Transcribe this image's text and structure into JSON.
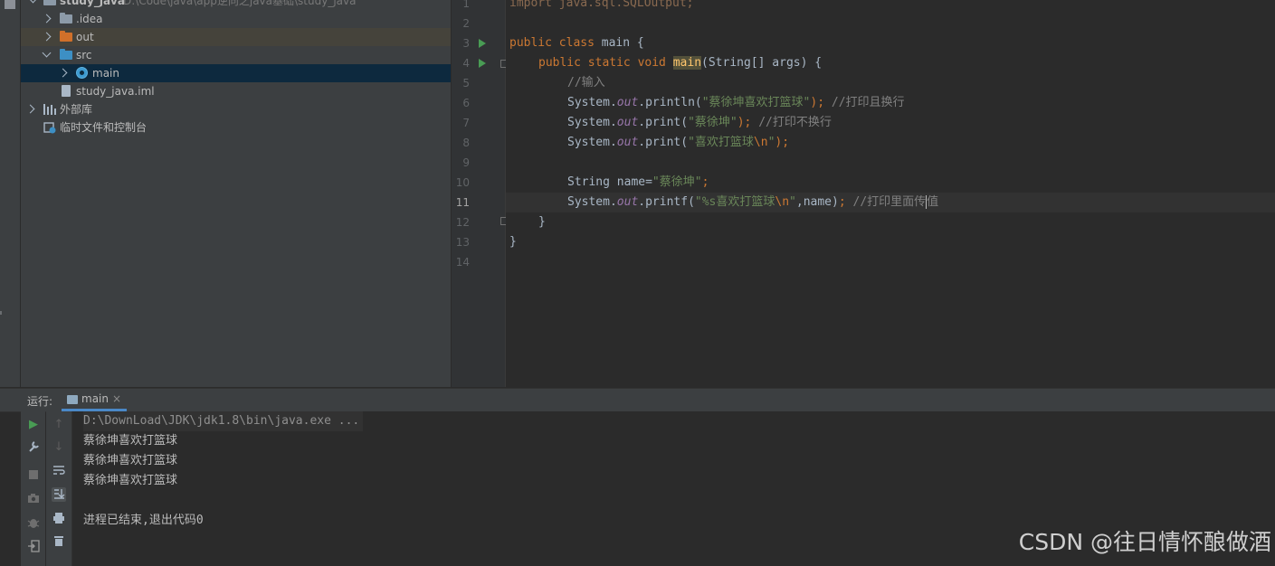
{
  "project_tree": {
    "root": {
      "name": "study_java",
      "path": "D:\\Code\\java\\app逆向之java基础\\study_java"
    },
    "items": [
      {
        "label": "idea",
        "prefix": "."
      },
      {
        "label": "out"
      },
      {
        "label": "src"
      },
      {
        "label": "main"
      },
      {
        "label": "study_java.iml"
      },
      {
        "label": "外部库"
      },
      {
        "label": "临时文件和控制台"
      }
    ]
  },
  "editor": {
    "line_numbers": [
      "1",
      "2",
      "3",
      "4",
      "5",
      "6",
      "7",
      "8",
      "9",
      "10",
      "11",
      "12",
      "13",
      "14"
    ],
    "current_line": "11",
    "lines": {
      "l1": "import java.sql.SQLOutput;",
      "l3_kw": "public class",
      "l3_name": " main {",
      "l4_kw": "public static void",
      "l4_method": "main",
      "l4_rest": "(String[] args) {",
      "l5_cmt": "//输入",
      "l6_a": "System.",
      "l6_field": "out",
      "l6_b": ".println(",
      "l6_str": "\"蔡徐坤喜欢打篮球\"",
      "l6_c": ");",
      "l6_cmt": " //打印且换行",
      "l7_a": "System.",
      "l7_field": "out",
      "l7_b": ".print(",
      "l7_str": "\"蔡徐坤\"",
      "l7_c": ");",
      "l7_cmt": " //打印不换行",
      "l8_a": "System.",
      "l8_field": "out",
      "l8_b": ".print(",
      "l8_str": "\"喜欢打篮球",
      "l8_esc": "\\n",
      "l8_str2": "\"",
      "l8_c": ");",
      "l10_a": "String name=",
      "l10_str": "\"蔡徐坤\"",
      "l10_c": ";",
      "l11_a": "System.",
      "l11_field": "out",
      "l11_b": ".printf(",
      "l11_str": "\"%s喜欢打篮球",
      "l11_esc": "\\n",
      "l11_str2": "\"",
      "l11_c": ",name)",
      "l11_semi": ";",
      "l11_cmt1": " //打印里面传",
      "l11_cmt2": "值",
      "l12": "}",
      "l13": "}"
    }
  },
  "run_panel": {
    "title": "运行:",
    "tab_label": "main",
    "tab_close": "×",
    "console": [
      "D:\\DownLoad\\JDK\\jdk1.8\\bin\\java.exe ...",
      "蔡徐坤喜欢打篮球",
      "蔡徐坤喜欢打篮球",
      "蔡徐坤喜欢打篮球",
      "",
      "进程已结束,退出代码0"
    ]
  },
  "watermark": "CSDN @往日情怀酿做酒",
  "colors": {
    "keyword": "#cc7832",
    "string": "#6a8759",
    "comment": "#808080",
    "field": "#9876aa",
    "method_highlight": "#ffc66d",
    "selection": "#0d293e",
    "run_green": "#499c54"
  }
}
